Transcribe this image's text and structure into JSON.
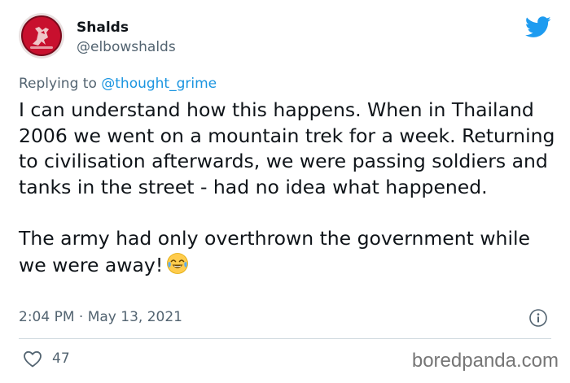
{
  "tweet": {
    "author_name": "Shalds",
    "author_handle": "@elbowshalds",
    "reply_prefix": "Replying to ",
    "reply_mention": "@thought_grime",
    "paragraph_1": "I can understand how this happens. When in Thailand 2006 we went on a mountain trek for a week. Returning to civilisation afterwards, we were passing soldiers and tanks in the street - had no idea what happened.",
    "paragraph_2": "The army had only overthrown the government while we were away!",
    "emoji": "face-with-tears-of-joy",
    "timestamp": "2:04 PM · May 13, 2021",
    "like_count": "47"
  },
  "watermark": "boredpanda.com",
  "icons": {
    "avatar": "liverpool-crest-avatar",
    "brand": "twitter-bird-icon",
    "info": "info-icon",
    "like": "heart-icon"
  },
  "colors": {
    "twitter_blue": "#1d9bf0",
    "mention": "#1b95e0",
    "secondary_text": "#536471",
    "primary_text": "#0f1419",
    "avatar_red": "#c8102e"
  }
}
